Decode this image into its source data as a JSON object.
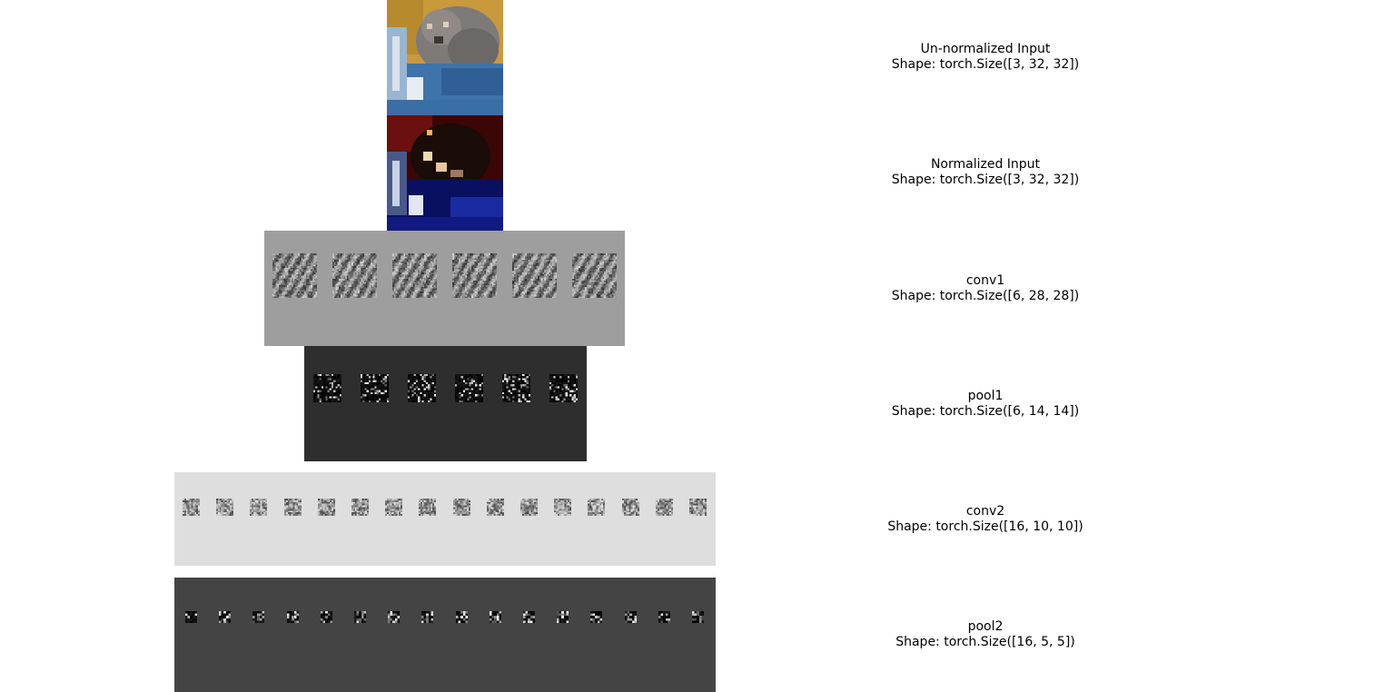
{
  "rows": [
    {
      "name": "Un-normalized Input",
      "shape": "Shape: torch.Size([3, 32, 32])"
    },
    {
      "name": "Normalized Input",
      "shape": "Shape: torch.Size([3, 32, 32])"
    },
    {
      "name": "conv1",
      "shape": "Shape: torch.Size([6, 28, 28])"
    },
    {
      "name": "pool1",
      "shape": "Shape: torch.Size([6, 14, 14])"
    },
    {
      "name": "conv2",
      "shape": "Shape: torch.Size([16, 10, 10])"
    },
    {
      "name": "pool2",
      "shape": "Shape: torch.Size([16, 5, 5])"
    }
  ],
  "feature_map_counts": {
    "conv1": 6,
    "pool1": 6,
    "conv2": 16,
    "pool2": 16
  },
  "colors": {
    "conv1_bg": "#9e9e9e",
    "pool1_bg": "#2e2e2e",
    "conv2_bg": "#dedede",
    "pool2_bg": "#444444"
  }
}
